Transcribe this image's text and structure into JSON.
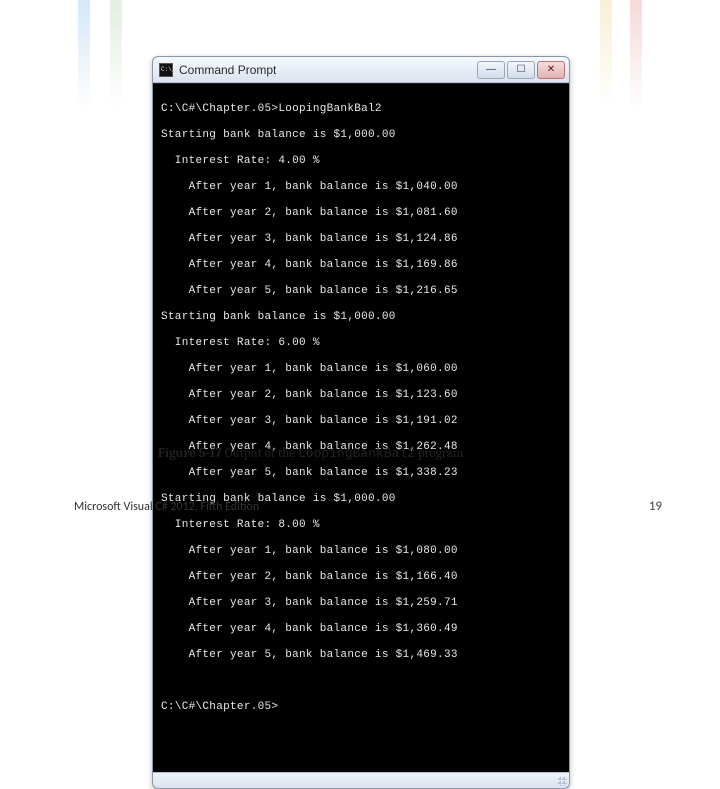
{
  "window": {
    "title": "Command Prompt",
    "minimize_glyph": "—",
    "maximize_glyph": "☐",
    "close_glyph": "✕"
  },
  "terminal": {
    "cmd_line": "C:\\C#\\Chapter.05>LoopingBankBal2",
    "blocks": [
      {
        "start": "Starting bank balance is $1,000.00",
        "rate": "  Interest Rate: 4.00 %",
        "years": [
          "    After year 1, bank balance is $1,040.00",
          "    After year 2, bank balance is $1,081.60",
          "    After year 3, bank balance is $1,124.86",
          "    After year 4, bank balance is $1,169.86",
          "    After year 5, bank balance is $1,216.65"
        ]
      },
      {
        "start": "Starting bank balance is $1,000.00",
        "rate": "  Interest Rate: 6.00 %",
        "years": [
          "    After year 1, bank balance is $1,060.00",
          "    After year 2, bank balance is $1,123.60",
          "    After year 3, bank balance is $1,191.02",
          "    After year 4, bank balance is $1,262.48",
          "    After year 5, bank balance is $1,338.23"
        ]
      },
      {
        "start": "Starting bank balance is $1,000.00",
        "rate": "  Interest Rate: 8.00 %",
        "years": [
          "    After year 1, bank balance is $1,080.00",
          "    After year 2, bank balance is $1,166.40",
          "    After year 3, bank balance is $1,259.71",
          "    After year 4, bank balance is $1,360.49",
          "    After year 5, bank balance is $1,469.33"
        ]
      }
    ],
    "prompt": "C:\\C#\\Chapter.05>"
  },
  "caption": {
    "fig_label": "Figure 5-17",
    "before": "  Output of the ",
    "program": "LoopingBankBal2",
    "after": " program"
  },
  "footer": {
    "left": "Microsoft Visual C# 2012, Fifth Edition",
    "right": "19"
  }
}
